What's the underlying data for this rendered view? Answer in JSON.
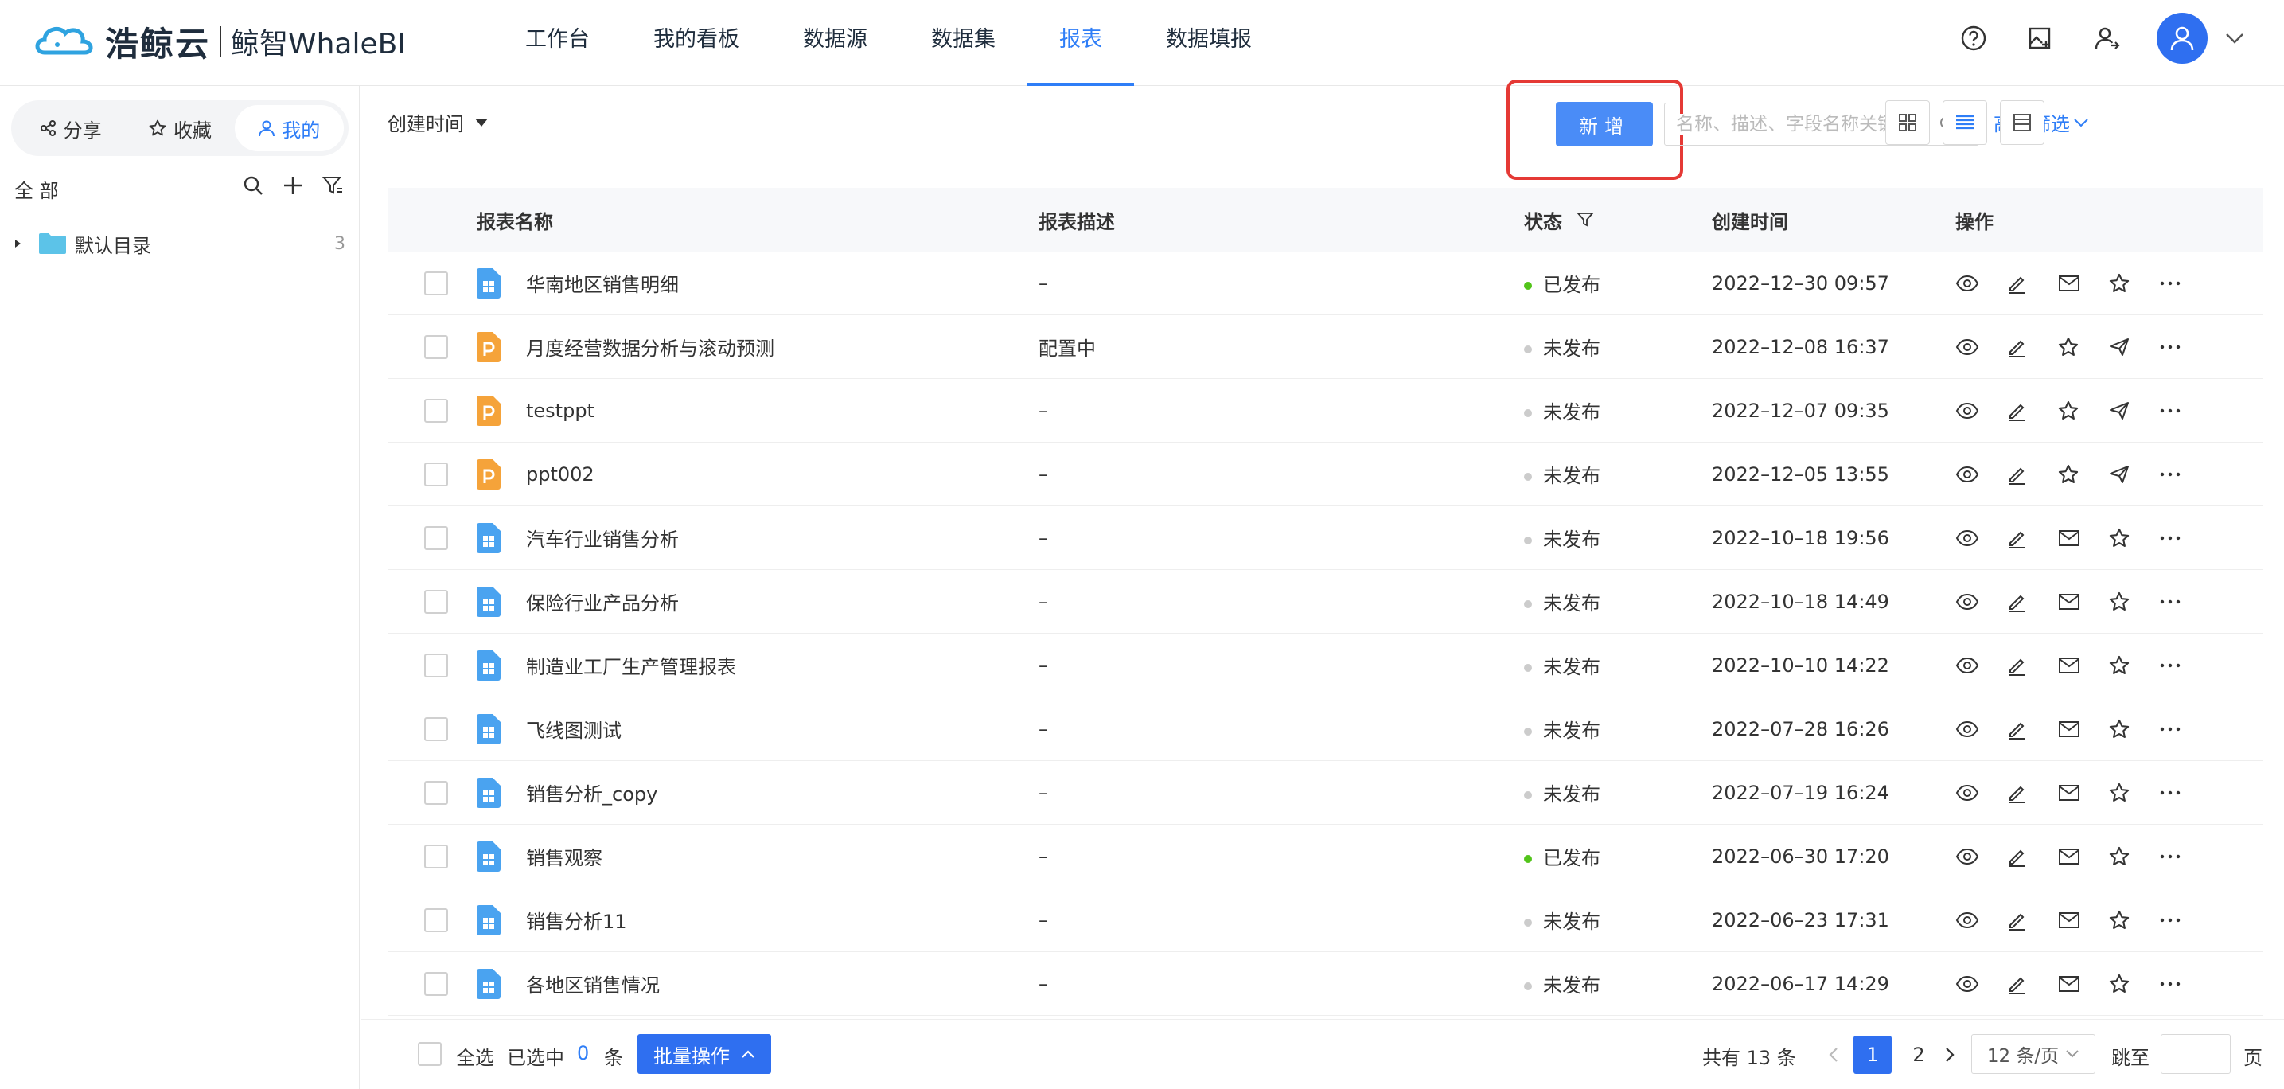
{
  "header": {
    "brand": "浩鲸云",
    "product": "鲸智WhaleBI",
    "nav": [
      {
        "label": "工作台",
        "active": false
      },
      {
        "label": "我的看板",
        "active": false
      },
      {
        "label": "数据源",
        "active": false
      },
      {
        "label": "数据集",
        "active": false
      },
      {
        "label": "报表",
        "active": true
      },
      {
        "label": "数据填报",
        "active": false
      }
    ]
  },
  "sidebar": {
    "tabs": [
      {
        "label": "分享",
        "icon": "share-icon"
      },
      {
        "label": "收藏",
        "icon": "star-icon"
      },
      {
        "label": "我的",
        "icon": "user-icon",
        "active": true
      }
    ],
    "all_label": "全 部",
    "folder": {
      "name": "默认目录",
      "count": "3"
    }
  },
  "toolbar": {
    "sort_label": "创建时间",
    "new_label": "新增",
    "search_placeholder": "名称、描述、字段名称关键字",
    "adv_filter_label": "高级筛选"
  },
  "table": {
    "columns": {
      "name": "报表名称",
      "desc": "报表描述",
      "status": "状态",
      "created": "创建时间",
      "ops": "操作"
    },
    "rows": [
      {
        "name": "华南地区销售明细",
        "type": "report",
        "desc": "–",
        "status": "已发布",
        "published": true,
        "created": "2022–12–30 09:57",
        "third_op": "mail"
      },
      {
        "name": "月度经营数据分析与滚动预测",
        "type": "ppt",
        "desc": "配置中",
        "status": "未发布",
        "published": false,
        "created": "2022–12–08 16:37",
        "third_op": "star"
      },
      {
        "name": "testppt",
        "type": "ppt",
        "desc": "–",
        "status": "未发布",
        "published": false,
        "created": "2022–12–07 09:35",
        "third_op": "star"
      },
      {
        "name": "ppt002",
        "type": "ppt",
        "desc": "–",
        "status": "未发布",
        "published": false,
        "created": "2022–12–05 13:55",
        "third_op": "star"
      },
      {
        "name": "汽车行业销售分析",
        "type": "report",
        "desc": "–",
        "status": "未发布",
        "published": false,
        "created": "2022–10–18 19:56",
        "third_op": "mail"
      },
      {
        "name": "保险行业产品分析",
        "type": "report",
        "desc": "–",
        "status": "未发布",
        "published": false,
        "created": "2022–10–18 14:49",
        "third_op": "mail"
      },
      {
        "name": "制造业工厂生产管理报表",
        "type": "report",
        "desc": "–",
        "status": "未发布",
        "published": false,
        "created": "2022–10–10 14:22",
        "third_op": "mail"
      },
      {
        "name": "飞线图测试",
        "type": "report",
        "desc": "–",
        "status": "未发布",
        "published": false,
        "created": "2022–07–28 16:26",
        "third_op": "mail"
      },
      {
        "name": "销售分析_copy",
        "type": "report",
        "desc": "–",
        "status": "未发布",
        "published": false,
        "created": "2022–07–19 16:24",
        "third_op": "mail"
      },
      {
        "name": "销售观察",
        "type": "report",
        "desc": "–",
        "status": "已发布",
        "published": true,
        "created": "2022–06–30 17:20",
        "third_op": "mail"
      },
      {
        "name": "销售分析11",
        "type": "report",
        "desc": "–",
        "status": "未发布",
        "published": false,
        "created": "2022–06–23 17:31",
        "third_op": "mail"
      },
      {
        "name": "各地区销售情况",
        "type": "report",
        "desc": "–",
        "status": "未发布",
        "published": false,
        "created": "2022–06–17 14:29",
        "third_op": "mail"
      }
    ]
  },
  "footer": {
    "select_all": "全选",
    "selected_prefix": "已选中",
    "selected_count": "0",
    "selected_suffix": "条",
    "batch_label": "批量操作",
    "total": "共有 13 条",
    "pages": [
      "1",
      "2"
    ],
    "page_size": "12 条/页",
    "jump_label": "跳至",
    "page_suffix": "页"
  },
  "colors": {
    "accent": "#2f7ef7",
    "published": "#52c41a",
    "unpublished": "#cccccc",
    "highlight": "#e53935"
  }
}
